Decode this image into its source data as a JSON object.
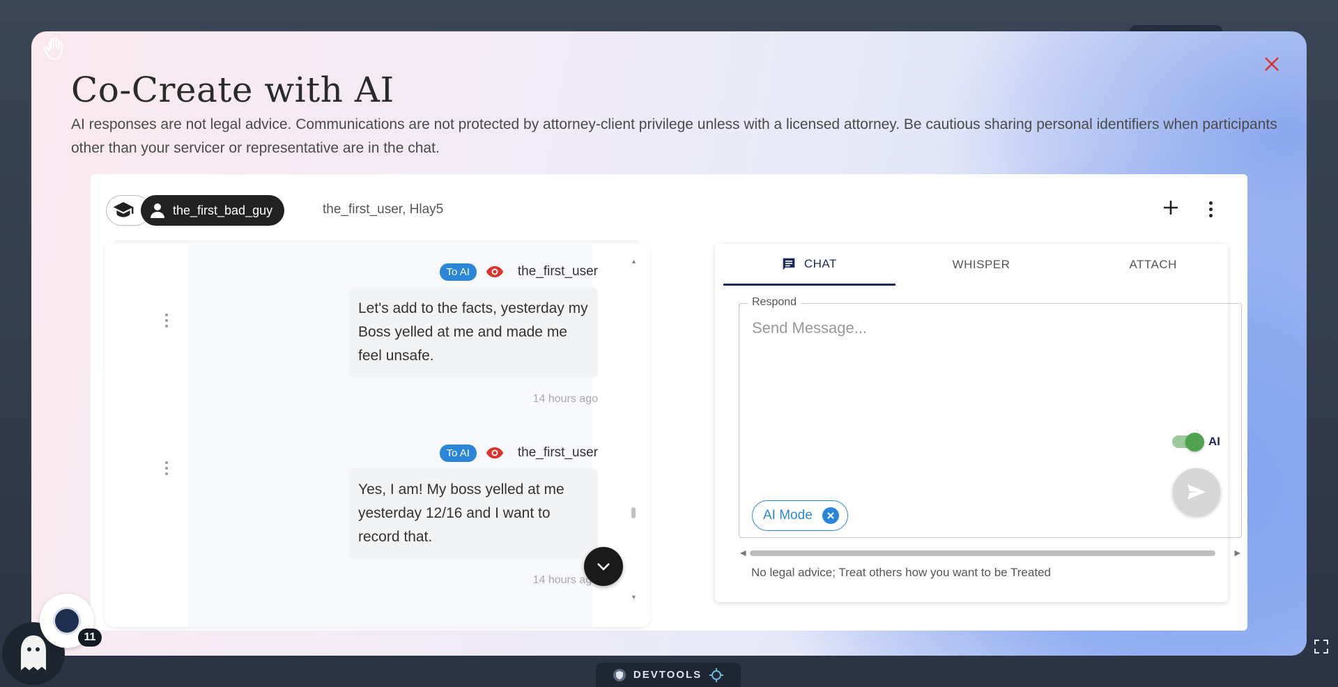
{
  "modal": {
    "title": "Co-Create with AI",
    "disclaimer": "AI responses are not legal advice. Communications are not protected by attorney-client privilege unless with a licensed attorney. Be cautious sharing personal identifiers when participants other than your servicer or representative are in the chat.",
    "close_icon": "close-icon",
    "hand_icon": "hand-pointer-icon"
  },
  "header": {
    "role_icon": "graduation-cap-icon",
    "user_chip_label": "the_first_bad_guy",
    "participants": "the_first_user, Hlay5",
    "add_icon": "plus-icon",
    "more_icon": "more-vert-icon"
  },
  "messages": [
    {
      "badge": "To AI",
      "user": "the_first_user",
      "text": "Let's add to the facts, yesterday my Boss yelled at me and made me feel unsafe.",
      "time": "14 hours ago"
    },
    {
      "badge": "To AI",
      "user": "the_first_user",
      "text": "Yes, I am! My boss yelled at me yesterday 12/16 and I want to record that.",
      "time": "14 hours ago"
    }
  ],
  "compose": {
    "tabs": [
      {
        "label": "CHAT",
        "active": true
      },
      {
        "label": "WHISPER",
        "active": false
      },
      {
        "label": "ATTACH",
        "active": false
      }
    ],
    "respond_label": "Respond",
    "placeholder": "Send Message...",
    "ai_toggle_label": "AI",
    "ai_toggle_on": true,
    "ai_mode_chip": "AI Mode",
    "footnote": "No legal advice; Treat others how you want to be Treated"
  },
  "floating": {
    "notification_count": "11",
    "devtools_label": "DEVTOOLS"
  },
  "colors": {
    "accent_blue": "#2b86d8",
    "tab_active": "#1e2a5e",
    "close_red": "#d9342b",
    "toggle_green": "#4fa34f",
    "eye_red": "#d9342b"
  }
}
